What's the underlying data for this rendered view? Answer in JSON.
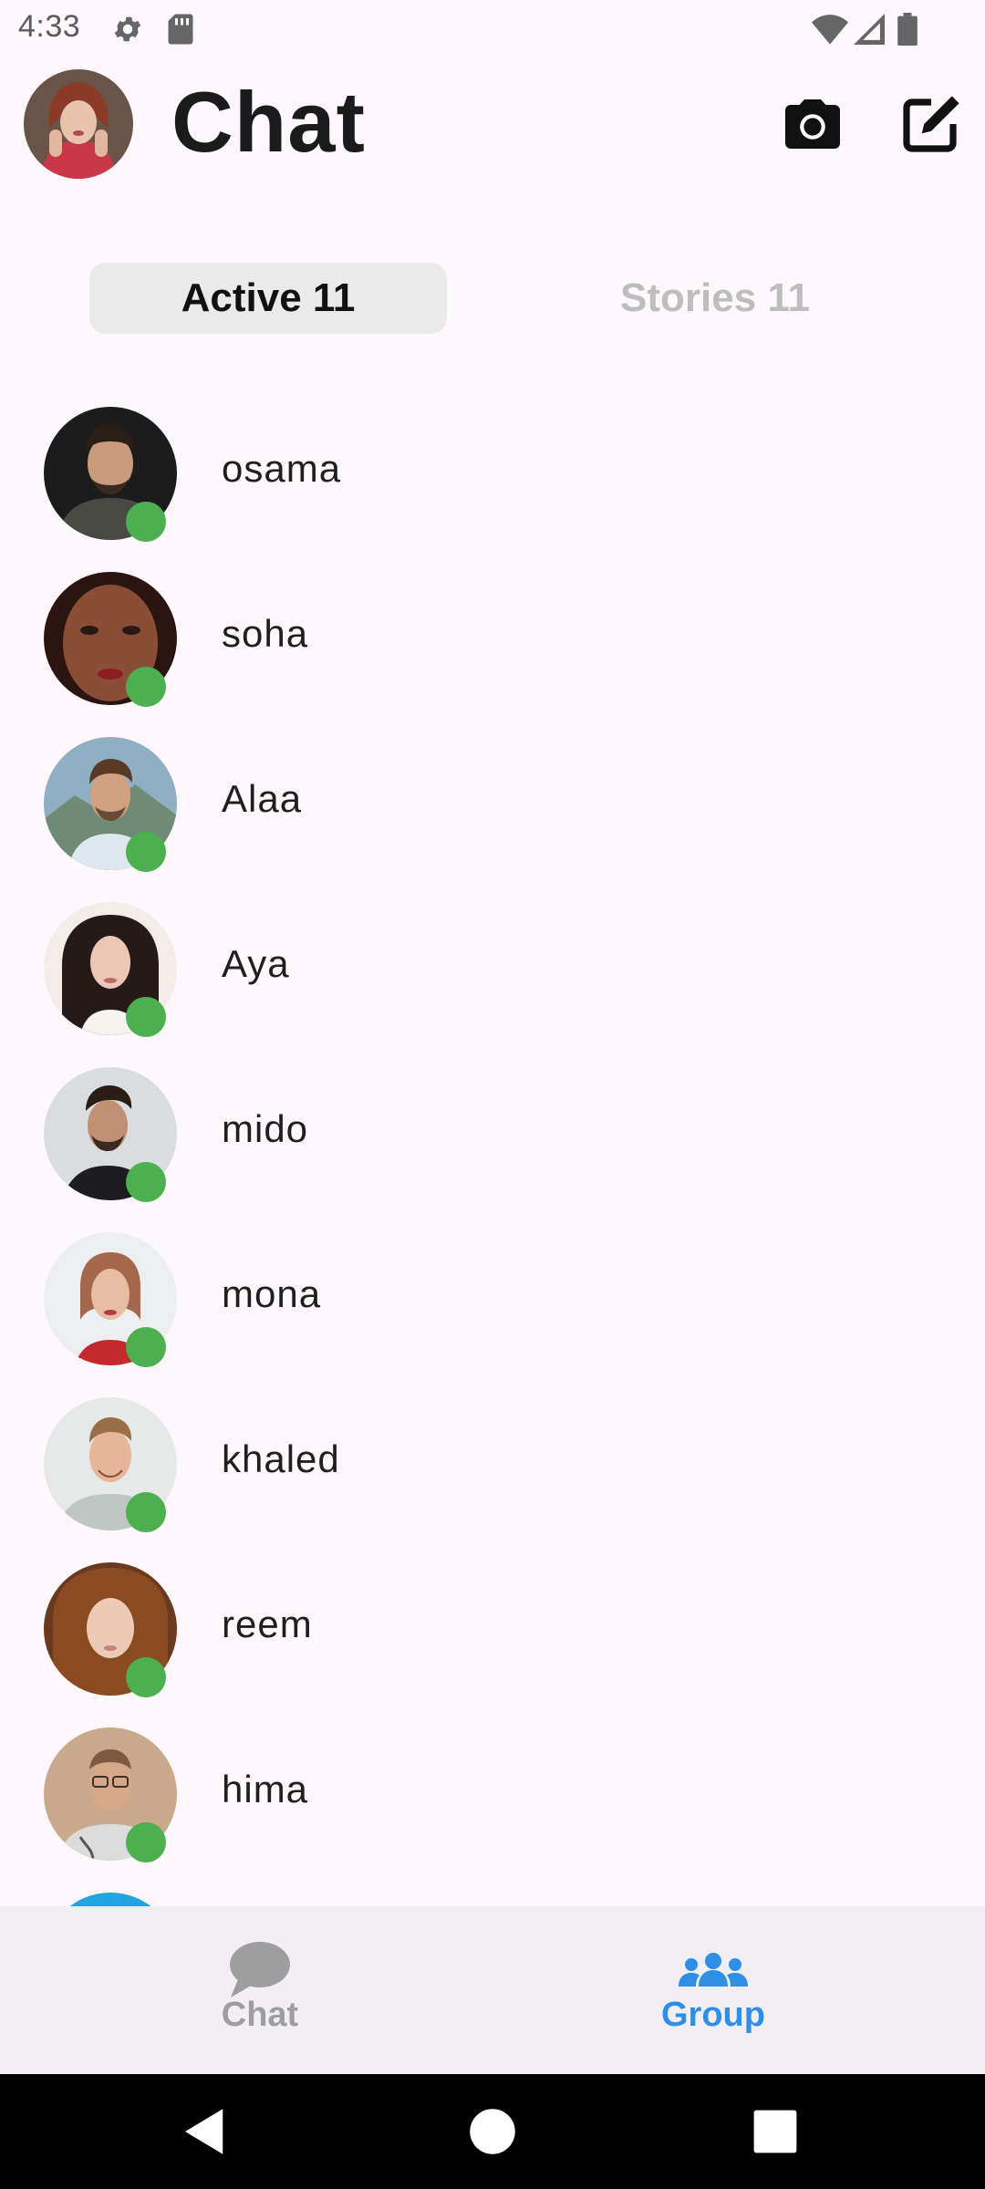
{
  "status_bar": {
    "time": "4:33",
    "icons": [
      "settings-gear-icon",
      "sd-card-icon",
      "wifi-icon",
      "cell-signal-icon",
      "battery-icon"
    ]
  },
  "header": {
    "title": "Chat",
    "actions": [
      "camera-icon",
      "edit-compose-icon"
    ]
  },
  "tabs": [
    {
      "label": "Active 11",
      "selected": true
    },
    {
      "label": "Stories 11",
      "selected": false
    }
  ],
  "contacts": [
    {
      "name": "osama",
      "online": true
    },
    {
      "name": "soha",
      "online": true
    },
    {
      "name": "Alaa",
      "online": true
    },
    {
      "name": "Aya",
      "online": true
    },
    {
      "name": "mido",
      "online": true
    },
    {
      "name": "mona",
      "online": true
    },
    {
      "name": "khaled",
      "online": true
    },
    {
      "name": "reem",
      "online": true
    },
    {
      "name": "hima",
      "online": true
    }
  ],
  "bottom_nav": {
    "items": [
      {
        "label": "Chat",
        "icon": "chat-bubble-icon",
        "active": false
      },
      {
        "label": "Group",
        "icon": "group-people-icon",
        "active": true
      }
    ]
  },
  "colors": {
    "background": "#FEF7FB",
    "online": "#4CAF50",
    "nav_active": "#2E8FE5",
    "nav_inactive": "#9E9E9E",
    "tab_selected_bg": "#EAEAEA"
  }
}
